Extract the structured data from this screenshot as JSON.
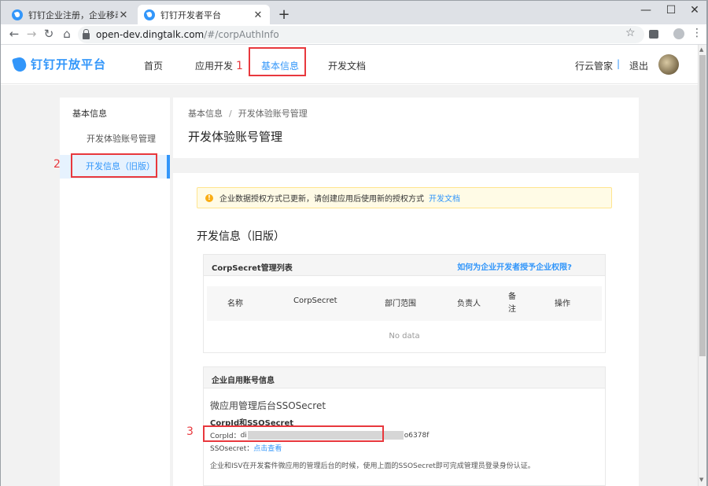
{
  "browser": {
    "tabs": [
      {
        "label": "钉钉企业注册，企业移动办公，",
        "close": "✕"
      },
      {
        "label": "钉钉开发者平台",
        "close": "✕"
      }
    ],
    "new_tab": "+",
    "window_controls": {
      "minimize": "—",
      "maximize": "☐",
      "close": "✕"
    },
    "nav": {
      "back": "←",
      "forward": "→",
      "reload": "↻",
      "home": "⌂"
    },
    "url_host": "open-dev.dingtalk.com",
    "url_path": "/#/corpAuthInfo",
    "star": "☆",
    "menu": "⋮"
  },
  "header": {
    "logo_text": "钉钉开放平台",
    "nav": [
      {
        "label": "首页"
      },
      {
        "label": "应用开发"
      },
      {
        "label": "基本信息"
      },
      {
        "label": "开发文档"
      }
    ],
    "user": "行云管家",
    "separator": "|",
    "logout": "退出"
  },
  "sidebar": {
    "title": "基本信息",
    "items": [
      {
        "label": "开发体验账号管理"
      },
      {
        "label": "开发信息（旧版）"
      }
    ]
  },
  "breadcrumb": {
    "root": "基本信息",
    "sep": "/",
    "current": "开发体验账号管理"
  },
  "page_title": "开发体验账号管理",
  "notice": {
    "icon": "!",
    "text": "企业数据授权方式已更新，请创建应用后使用新的授权方式",
    "link": "开发文档"
  },
  "section_title": "开发信息（旧版）",
  "corpsecret_card": {
    "title": "CorpSecret管理列表",
    "help_link": "如何为企业开发者授予企业权限?",
    "columns": [
      "名称",
      "CorpSecret",
      "部门范围",
      "负责人",
      "备",
      "注",
      "操作"
    ],
    "empty": "No data"
  },
  "account_card": {
    "title": "企业自用账号信息",
    "subtitle": "微应用管理后台SSOSecret",
    "heading": "CorpId和SSOSecret",
    "corpid_label": "CorpId：",
    "corpid_prefix": "di",
    "corpid_suffix": "o6378f",
    "ssosecret_label": "SSOsecret：",
    "ssosecret_link": "点击查看",
    "description": "企业和ISV在开发套件微应用的管理后台的时候，使用上面的SSOSecret即可完成管理员登录身份认证。"
  },
  "annotations": {
    "n1": "1",
    "n2": "2",
    "n3": "3"
  },
  "colors": {
    "accent": "#3296fa",
    "annotation": "#e8383d",
    "notice_bg": "#fffbe6"
  }
}
